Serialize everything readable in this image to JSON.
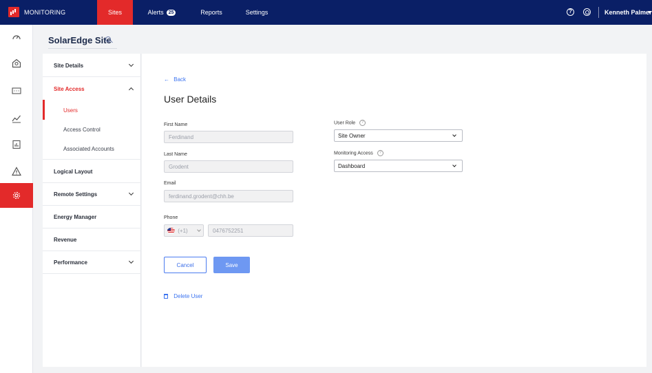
{
  "topbar": {
    "brand": "MONITORING",
    "tabs": [
      {
        "label": "Sites",
        "active": true
      },
      {
        "label": "Alerts",
        "badge": "25",
        "active": false
      },
      {
        "label": "Reports",
        "active": false
      },
      {
        "label": "Settings",
        "active": false
      }
    ],
    "user_name": "Kenneth Palmer",
    "icons": [
      "help-icon",
      "support-icon"
    ]
  },
  "rail": {
    "items": [
      {
        "icon": "dashboard-gauge-icon",
        "active": false
      },
      {
        "icon": "site-layout-icon",
        "active": false
      },
      {
        "icon": "panels-grid-icon",
        "active": false
      },
      {
        "icon": "charts-trend-icon",
        "active": false
      },
      {
        "icon": "reports-icon",
        "active": false
      },
      {
        "icon": "alerts-warning-icon",
        "active": false
      },
      {
        "icon": "settings-gear-icon",
        "active": true
      }
    ]
  },
  "site": {
    "title": "SolarEdge Site"
  },
  "sidenav": {
    "items": [
      {
        "label": "Site Details",
        "expandable": true,
        "expanded": false
      },
      {
        "label": "Site Access",
        "expandable": true,
        "expanded": true,
        "active": true,
        "children": [
          {
            "label": "Users",
            "active": true
          },
          {
            "label": "Access Control",
            "active": false
          },
          {
            "label": "Associated Accounts",
            "active": false
          }
        ]
      },
      {
        "label": "Logical Layout",
        "expandable": false
      },
      {
        "label": "Remote Settings",
        "expandable": true,
        "expanded": false
      },
      {
        "label": "Energy Manager",
        "expandable": false
      },
      {
        "label": "Revenue",
        "expandable": false
      },
      {
        "label": "Performance",
        "expandable": true,
        "expanded": false
      }
    ]
  },
  "form": {
    "back_label": "Back",
    "title": "User Details",
    "first_name": {
      "label": "First Name",
      "value": "Ferdinand"
    },
    "last_name": {
      "label": "Last Name",
      "value": "Grodent"
    },
    "email": {
      "label": "Email",
      "value": "ferdinand.grodent@chh.be"
    },
    "phone": {
      "label": "Phone",
      "country_code": "(+1)",
      "number": "0476752251"
    },
    "user_role": {
      "label": "User Role",
      "value": "Site Owner"
    },
    "monitoring_access": {
      "label": "Monitoring Access",
      "value": "Dashboard"
    },
    "cancel_label": "Cancel",
    "save_label": "Save",
    "delete_label": "Delete User"
  },
  "colors": {
    "nav_bg": "#0a1f66",
    "accent_red": "#e32a2a",
    "link_blue": "#3b73f0",
    "save_blue": "#6e98f2"
  }
}
